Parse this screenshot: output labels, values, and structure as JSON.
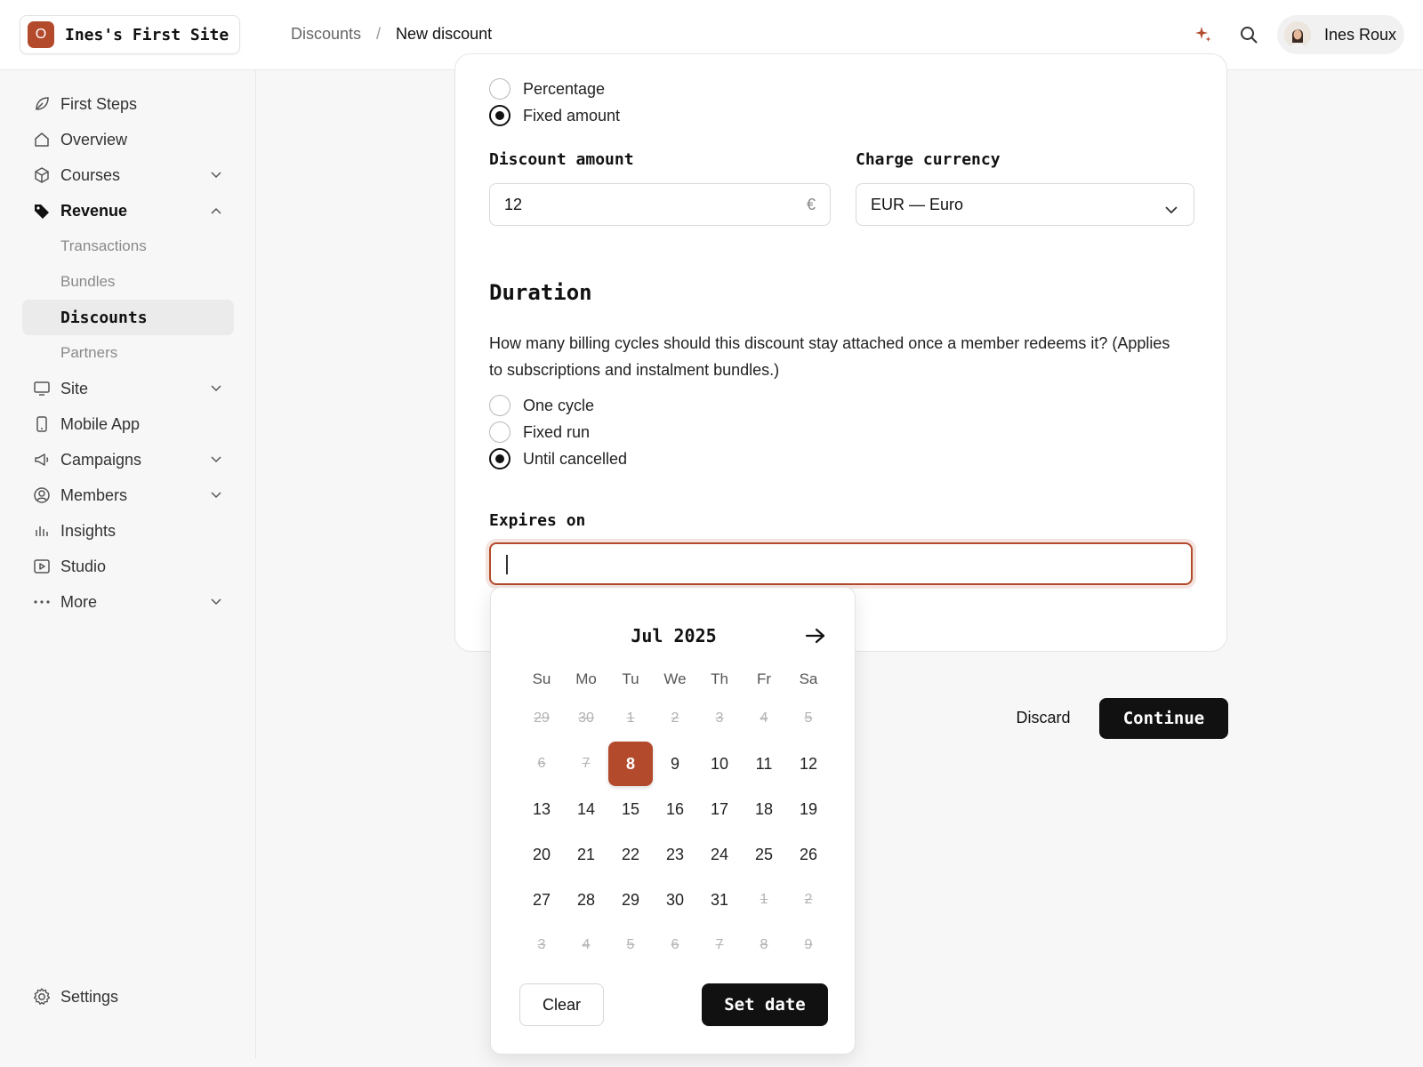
{
  "topbar": {
    "site_logo_letter": "O",
    "site_name": "Ines's First Site",
    "breadcrumb": {
      "parent": "Discounts",
      "separator": "/",
      "current": "New discount"
    },
    "user_name": "Ines Roux"
  },
  "sidebar": {
    "items": [
      {
        "label": "First Steps",
        "icon": "leaf-icon"
      },
      {
        "label": "Overview",
        "icon": "home-icon"
      },
      {
        "label": "Courses",
        "icon": "cube-icon"
      },
      {
        "label": "Revenue",
        "icon": "tag-icon"
      },
      {
        "label": "Transactions"
      },
      {
        "label": "Bundles"
      },
      {
        "label": "Discounts"
      },
      {
        "label": "Partners"
      },
      {
        "label": "Site",
        "icon": "monitor-icon"
      },
      {
        "label": "Mobile App",
        "icon": "phone-icon"
      },
      {
        "label": "Campaigns",
        "icon": "megaphone-icon"
      },
      {
        "label": "Members",
        "icon": "user-circle-icon"
      },
      {
        "label": "Insights",
        "icon": "bar-chart-icon"
      },
      {
        "label": "Studio",
        "icon": "play-icon"
      },
      {
        "label": "More",
        "icon": "more-icon"
      }
    ],
    "settings_label": "Settings"
  },
  "form": {
    "discount_type": {
      "options": [
        "Percentage",
        "Fixed amount"
      ],
      "selected": "Fixed amount"
    },
    "amount": {
      "label": "Discount amount",
      "value": "12",
      "suffix": "€"
    },
    "currency": {
      "label": "Charge currency",
      "value": "EUR — Euro"
    },
    "duration": {
      "title": "Duration",
      "help": "How many billing cycles should this discount stay attached once a member redeems it? (Applies to subscriptions and instalment bundles.)",
      "options": [
        "One cycle",
        "Fixed run",
        "Until cancelled"
      ],
      "selected": "Until cancelled"
    },
    "expires": {
      "label": "Expires on",
      "value": ""
    }
  },
  "actions": {
    "discard": "Discard",
    "continue": "Continue"
  },
  "calendar": {
    "month_label": "Jul 2025",
    "weekdays": [
      "Su",
      "Mo",
      "Tu",
      "We",
      "Th",
      "Fr",
      "Sa"
    ],
    "weeks": [
      [
        {
          "d": "29",
          "m": true
        },
        {
          "d": "30",
          "m": true
        },
        {
          "d": "1",
          "m": true
        },
        {
          "d": "2",
          "m": true
        },
        {
          "d": "3",
          "m": true
        },
        {
          "d": "4",
          "m": true
        },
        {
          "d": "5",
          "m": true
        }
      ],
      [
        {
          "d": "6",
          "m": true
        },
        {
          "d": "7",
          "m": true
        },
        {
          "d": "8",
          "s": true
        },
        {
          "d": "9"
        },
        {
          "d": "10"
        },
        {
          "d": "11"
        },
        {
          "d": "12"
        }
      ],
      [
        {
          "d": "13"
        },
        {
          "d": "14"
        },
        {
          "d": "15"
        },
        {
          "d": "16"
        },
        {
          "d": "17"
        },
        {
          "d": "18"
        },
        {
          "d": "19"
        }
      ],
      [
        {
          "d": "20"
        },
        {
          "d": "21"
        },
        {
          "d": "22"
        },
        {
          "d": "23"
        },
        {
          "d": "24"
        },
        {
          "d": "25"
        },
        {
          "d": "26"
        }
      ],
      [
        {
          "d": "27"
        },
        {
          "d": "28"
        },
        {
          "d": "29"
        },
        {
          "d": "30"
        },
        {
          "d": "31"
        },
        {
          "d": "1",
          "m": true
        },
        {
          "d": "2",
          "m": true
        }
      ],
      [
        {
          "d": "3",
          "m": true
        },
        {
          "d": "4",
          "m": true
        },
        {
          "d": "5",
          "m": true
        },
        {
          "d": "6",
          "m": true
        },
        {
          "d": "7",
          "m": true
        },
        {
          "d": "8",
          "m": true
        },
        {
          "d": "9",
          "m": true
        }
      ]
    ],
    "selected_day": "8",
    "clear_label": "Clear",
    "set_label": "Set date"
  },
  "colors": {
    "accent": "#b34a2c",
    "primary_button": "#111111"
  }
}
